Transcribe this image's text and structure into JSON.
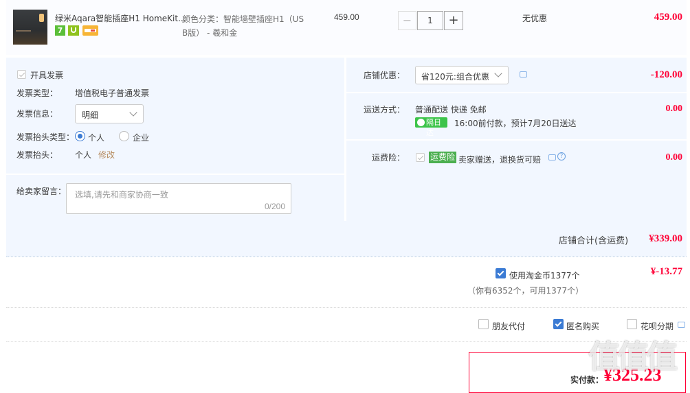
{
  "product": {
    "title": "绿米Aqara智能插座H1 HomeKit...",
    "variant_line1": "颜色分类：智能墙壁插座H1（US",
    "variant_line2": "B版） - 羲和金",
    "unit_price": "459.00",
    "quantity": "1",
    "minus": "−",
    "plus": "+",
    "discount": "无优惠",
    "subtotal": "459.00",
    "badge_7": "7"
  },
  "invoice": {
    "checkbox_label": "开具发票",
    "type_label": "发票类型：",
    "type_value": "增值税电子普通发票",
    "info_label": "发票信息：",
    "info_value": "明细",
    "header_type_label": "发票抬头类型：",
    "option_personal": "个人",
    "option_company": "企业",
    "header_label": "发票抬头：",
    "header_value": "个人",
    "modify_link": "修改"
  },
  "message": {
    "label": "给卖家留言：",
    "placeholder": "选填,请先和商家协商一致",
    "counter": "0/200"
  },
  "shop": {
    "coupon_label": "店铺优惠：",
    "coupon_value": "省120元:组合优惠",
    "coupon_amount": "-120.00",
    "delivery_label": "运送方式：",
    "delivery_value": "普通配送 快递 免邮",
    "delivery_badge": "隔日达",
    "delivery_note": "16:00前付款，预计7月20日送达",
    "delivery_amount": "0.00",
    "insurance_label": "运费险：",
    "insurance_badge": "运费险",
    "insurance_text": "卖家赠送，退换货可赔",
    "insurance_amount": "0.00",
    "total_label": "店铺合计(含运费)",
    "total_value": "¥339.00"
  },
  "coins": {
    "label": "使用淘金币1377个",
    "note": "（你有6352个，可用1377个）",
    "amount": "¥-13.77"
  },
  "options": {
    "friend_pay": "朋友代付",
    "anonymous": "匿名购买",
    "huabei": "花呗分期"
  },
  "payment": {
    "label": "实付款：",
    "amount": "¥325.23"
  },
  "watermark": "值值值"
}
